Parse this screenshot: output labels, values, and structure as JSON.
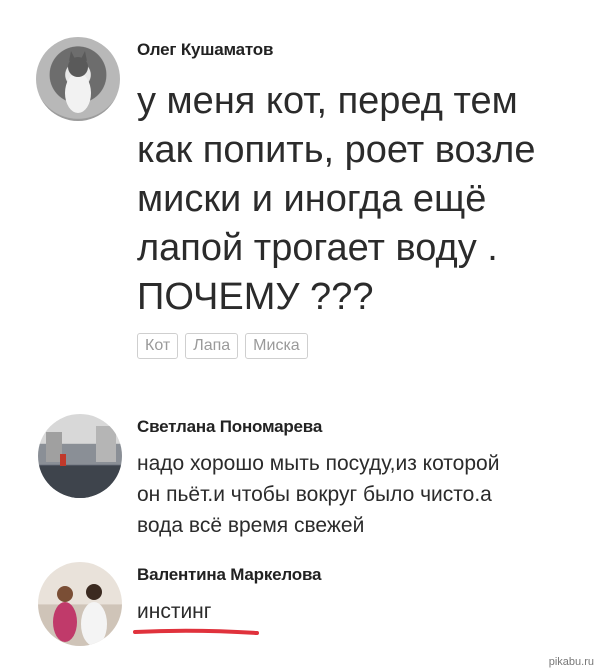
{
  "post": {
    "author": "Олег Кушаматов",
    "lines": [
      "у меня кот, перед тем",
      "как попить, роет возле",
      "миски и иногда ещё",
      "лапой трогает воду .",
      "ПОЧЕМУ ???"
    ],
    "tags": [
      "Кот",
      "Лапа",
      "Миска"
    ]
  },
  "comments": [
    {
      "author": "Светлана Пономарева",
      "lines": [
        "надо хорошо мыть посуду,из которой",
        "он пьёт.и чтобы вокруг было чисто.а",
        "вода всё время свежей"
      ]
    },
    {
      "author": "Валентина Маркелова",
      "lines": [
        "инстинг"
      ]
    }
  ],
  "watermark": "pikabu.ru",
  "colors": {
    "underline": "#e0323c",
    "tag_border": "#cfcfcf"
  }
}
